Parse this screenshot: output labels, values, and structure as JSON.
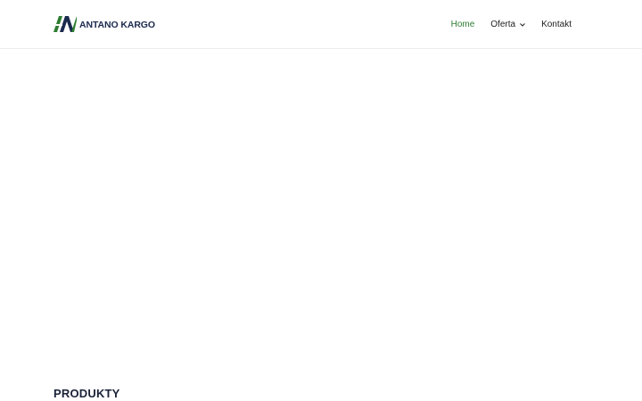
{
  "brand": {
    "name": "ANTANO KARGO",
    "colors": {
      "navy": "#1b2a4e",
      "green": "#2e7d32"
    }
  },
  "nav": {
    "items": [
      {
        "label": "Home",
        "active": true
      },
      {
        "label": "Oferta",
        "has_dropdown": true,
        "icon": "chevron-down-icon"
      },
      {
        "label": "Kontakt"
      }
    ]
  },
  "main": {
    "section_title": "PRODUKTY"
  }
}
